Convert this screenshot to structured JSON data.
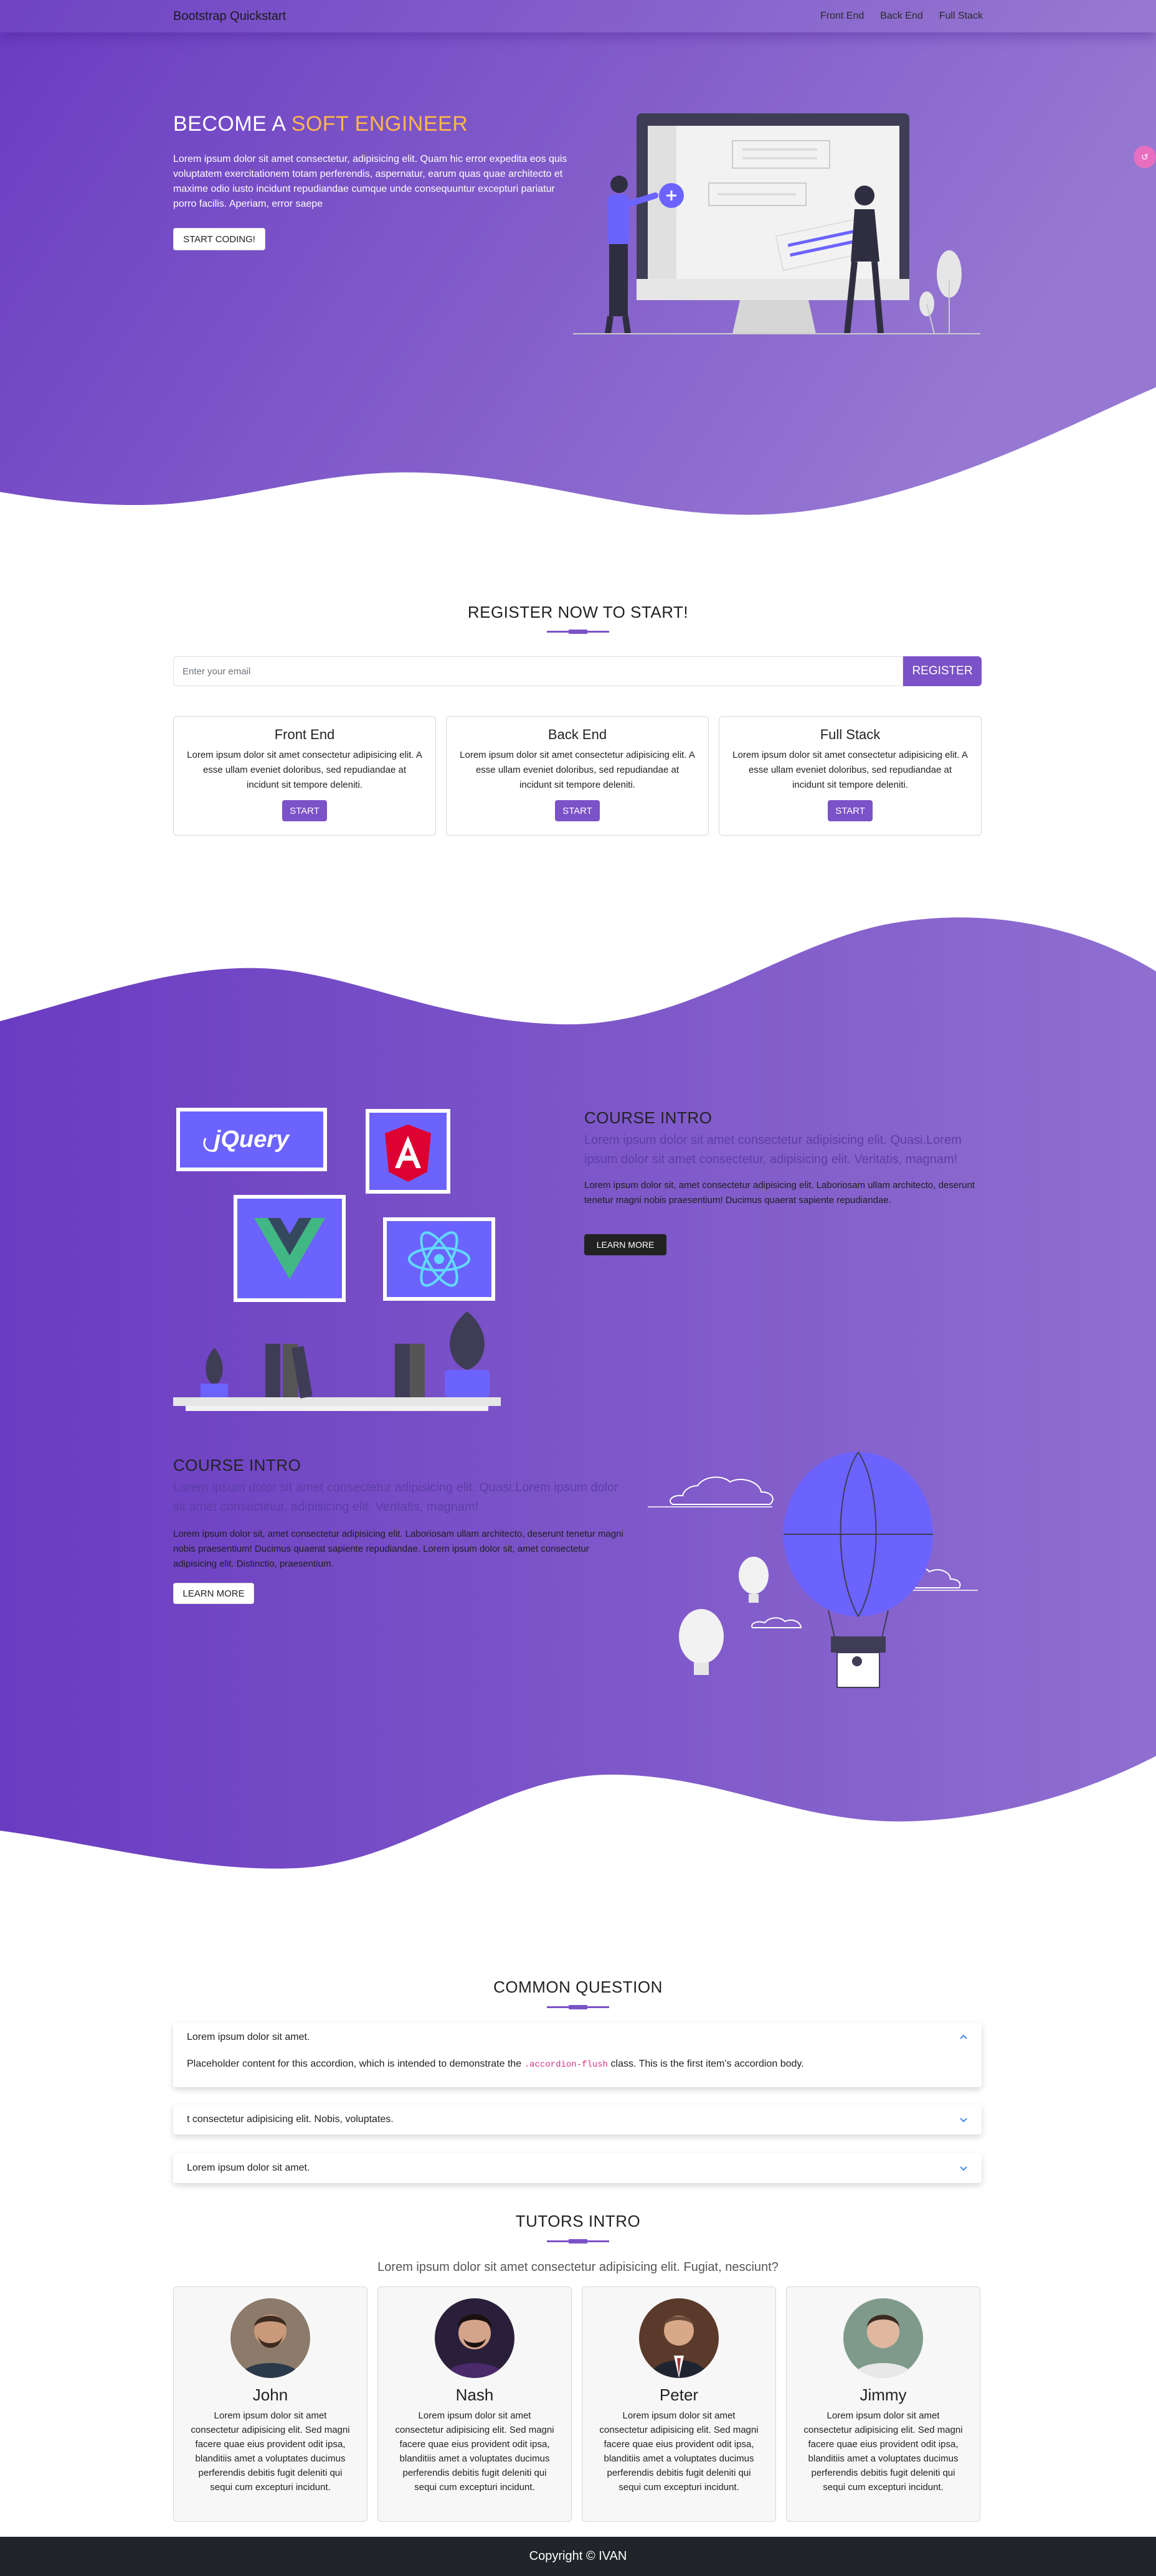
{
  "nav": {
    "brand": "Bootstrap Quickstart",
    "links": [
      "Front End",
      "Back End",
      "Full Stack"
    ]
  },
  "hero": {
    "title_prefix": "BECOME A ",
    "title_accent": "SOFT ENGINEER",
    "text": "Lorem ipsum dolor sit amet consectetur, adipisicing elit. Quam hic error expedita eos quis voluptatem exercitationem totam perferendis, aspernatur, earum quas quae architecto et maxime odio iusto incidunt repudiandae cumque unde consequuntur excepturi pariatur porro facilis. Aperiam, error saepe",
    "button": "START CODING!"
  },
  "register": {
    "title": "REGISTER NOW TO START!",
    "placeholder": "Enter your email",
    "button": "REGISTER"
  },
  "courses": [
    {
      "title": "Front End",
      "text": "Lorem ipsum dolor sit amet consectetur adipisicing elit. A esse ullam eveniet doloribus, sed repudiandae at incidunt sit tempore deleniti.",
      "button": "START"
    },
    {
      "title": "Back End",
      "text": "Lorem ipsum dolor sit amet consectetur adipisicing elit. A esse ullam eveniet doloribus, sed repudiandae at incidunt sit tempore deleniti.",
      "button": "START"
    },
    {
      "title": "Full Stack",
      "text": "Lorem ipsum dolor sit amet consectetur adipisicing elit. A esse ullam eveniet doloribus, sed repudiandae at incidunt sit tempore deleniti.",
      "button": "START"
    }
  ],
  "intro1": {
    "title": "COURSE INTRO",
    "lead": "Lorem ipsum dolor sit amet consectetur adipisicing elit. Quasi.Lorem ipsum dolor sit amet consectetur, adipisicing elit. Veritatis, magnam!",
    "text": "Lorem ipsum dolor sit, amet consectetur adipisicing elit. Laboriosam ullam architecto, deserunt tenetur magni nobis praesentium! Ducimus quaerat sapiente repudiandae.",
    "button": "LEARN MORE",
    "logos": [
      "jQuery"
    ]
  },
  "intro2": {
    "title": "COURSE INTRO",
    "lead": "Lorem ipsum dolor sit amet consectetur adipisicing elit. Quasi.Lorem ipsum dolor sit amet consectetur, adipisicing elit. Veritatis, magnam!",
    "text": "Lorem ipsum dolor sit, amet consectetur adipisicing elit. Laboriosam ullam architecto, deserunt tenetur magni nobis praesentium! Ducimus quaerat sapiente repudiandae. Lorem ipsum dolor sit, amet consectetur adipisicing elit. Distinctio, praesentium.",
    "button": "LEARN MORE"
  },
  "faq": {
    "title": "COMMON QUESTION",
    "items": [
      {
        "question": "Lorem ipsum dolor sit amet.",
        "body_before": "Placeholder content for this accordion, which is intended to demonstrate the ",
        "body_code": ".accordion-flush",
        "body_after": " class. This is the first item's accordion body."
      },
      {
        "question": "t consectetur adipisicing elit. Nobis, voluptates."
      },
      {
        "question": "Lorem ipsum dolor sit amet."
      }
    ]
  },
  "tutors": {
    "title": "TUTORS INTRO",
    "subtitle": "Lorem ipsum dolor sit amet consectetur adipisicing elit. Fugiat, nesciunt?",
    "people": [
      {
        "name": "John",
        "text": "Lorem ipsum dolor sit amet consectetur adipisicing elit. Sed magni facere quae eius provident odit ipsa, blanditiis amet a voluptates ducimus perferendis debitis fugit deleniti qui sequi cum excepturi incidunt."
      },
      {
        "name": "Nash",
        "text": "Lorem ipsum dolor sit amet consectetur adipisicing elit. Sed magni facere quae eius provident odit ipsa, blanditiis amet a voluptates ducimus perferendis debitis fugit deleniti qui sequi cum excepturi incidunt."
      },
      {
        "name": "Peter",
        "text": "Lorem ipsum dolor sit amet consectetur adipisicing elit. Sed magni facere quae eius provident odit ipsa, blanditiis amet a voluptates ducimus perferendis debitis fugit deleniti qui sequi cum excepturi incidunt."
      },
      {
        "name": "Jimmy",
        "text": "Lorem ipsum dolor sit amet consectetur adipisicing elit. Sed magni facere quae eius provident odit ipsa, blanditiis amet a voluptates ducimus perferendis debitis fugit deleniti qui sequi cum excepturi incidunt."
      }
    ]
  },
  "footer": {
    "text": "Copyright © IVAN"
  },
  "colors": {
    "primary": "#7b52c8",
    "accent": "#ffb64a",
    "gradient_start": "#6a3cc1",
    "gradient_end": "#8f6fd0",
    "footer": "#212529"
  }
}
